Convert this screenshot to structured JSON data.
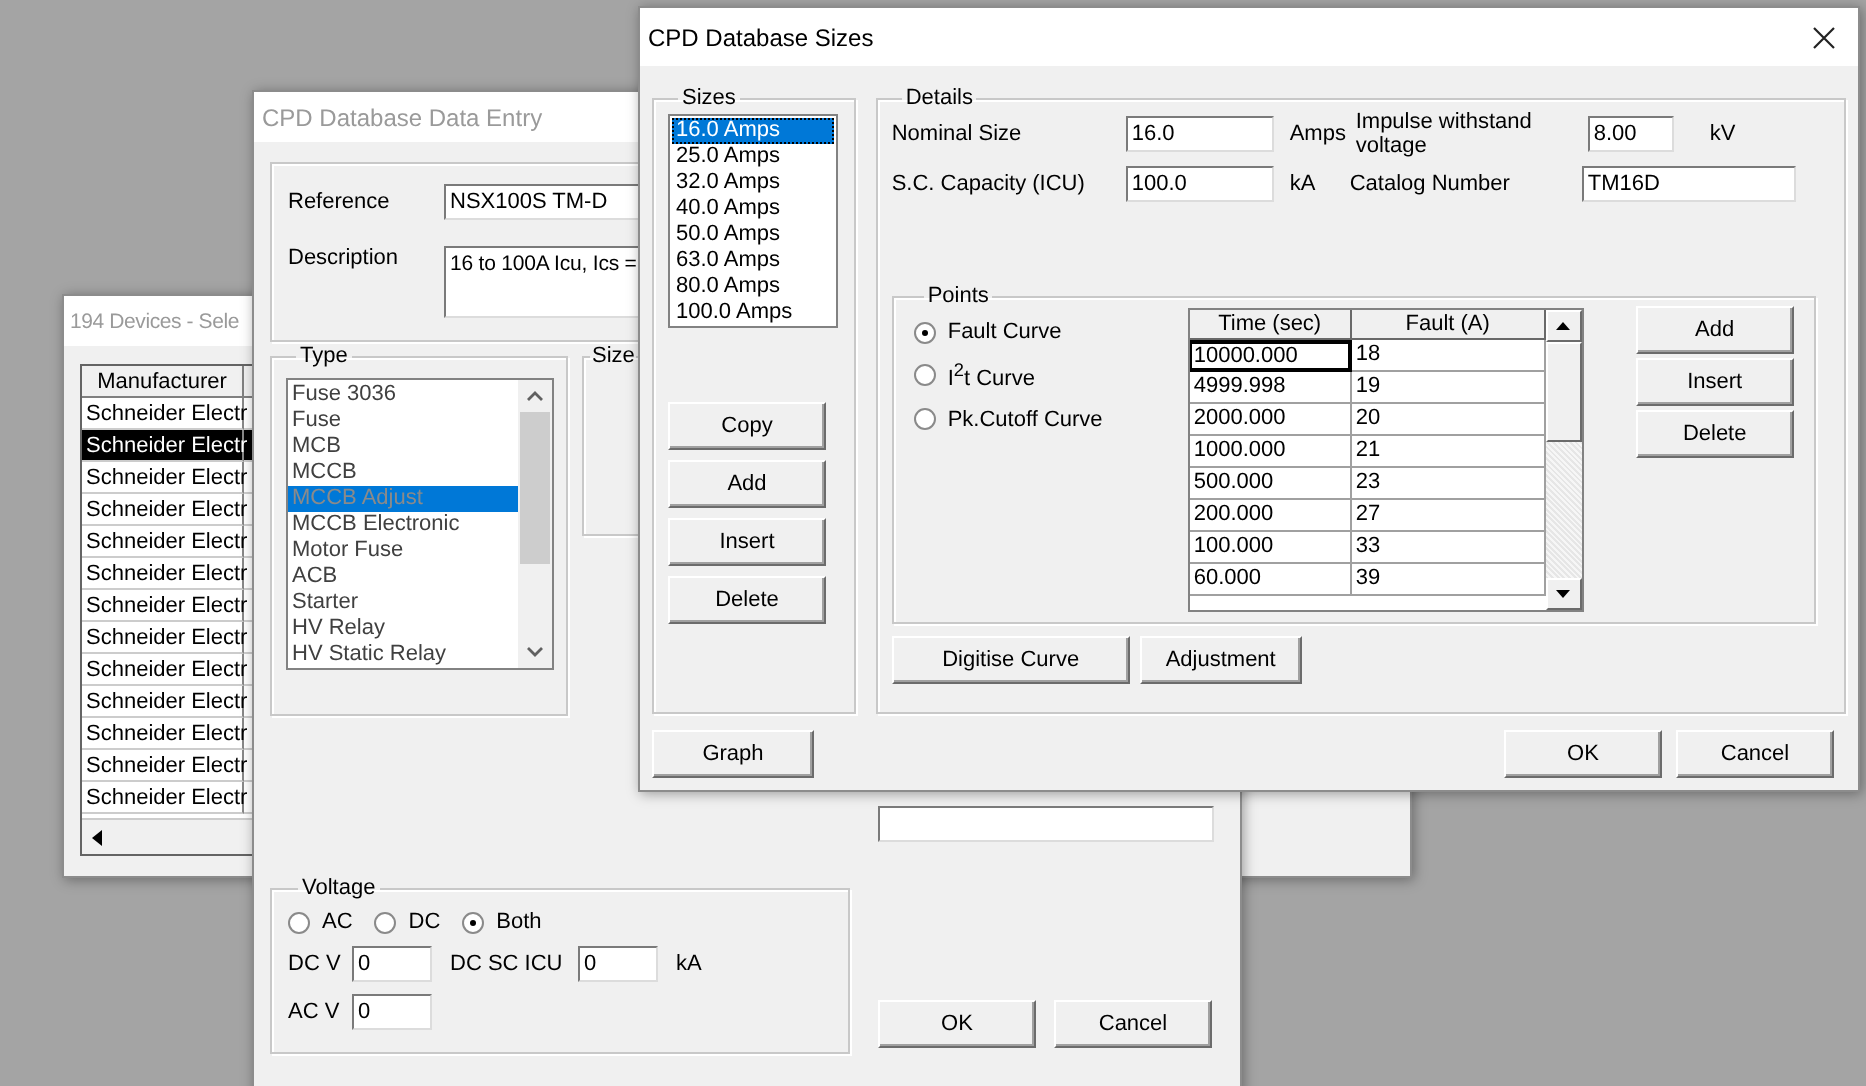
{
  "devices_window": {
    "title": "194 Devices - Sele",
    "columns": [
      "Manufacturer"
    ],
    "rows": [
      {
        "manufacturer": "Schneider Electr",
        "selected": false
      },
      {
        "manufacturer": "Schneider Electr",
        "selected": true
      },
      {
        "manufacturer": "Schneider Electr",
        "selected": false
      },
      {
        "manufacturer": "Schneider Electr",
        "selected": false
      },
      {
        "manufacturer": "Schneider Electr",
        "selected": false
      },
      {
        "manufacturer": "Schneider Electr",
        "selected": false
      },
      {
        "manufacturer": "Schneider Electr",
        "selected": false
      },
      {
        "manufacturer": "Schneider Electr",
        "selected": false
      },
      {
        "manufacturer": "Schneider Electr",
        "selected": false
      },
      {
        "manufacturer": "Schneider Electr",
        "selected": false
      },
      {
        "manufacturer": "Schneider Electr",
        "selected": false
      },
      {
        "manufacturer": "Schneider Electr",
        "selected": false
      },
      {
        "manufacturer": "Schneider Electr",
        "selected": false
      }
    ]
  },
  "entry_window": {
    "title": "CPD Database Data Entry",
    "reference_label": "Reference",
    "reference": "NSX100S TM-D",
    "description_label": "Description",
    "description": "16 to 100A Icu, Ics =",
    "type_group": "Type",
    "types": [
      {
        "label": "Fuse 3036",
        "selected": false
      },
      {
        "label": "Fuse",
        "selected": false
      },
      {
        "label": "MCB",
        "selected": false
      },
      {
        "label": "MCCB",
        "selected": false
      },
      {
        "label": "MCCB Adjust",
        "selected": true
      },
      {
        "label": "MCCB Electronic",
        "selected": false
      },
      {
        "label": "Motor Fuse",
        "selected": false
      },
      {
        "label": "ACB",
        "selected": false
      },
      {
        "label": "Starter",
        "selected": false
      },
      {
        "label": "HV Relay",
        "selected": false
      },
      {
        "label": "HV Static Relay",
        "selected": false
      }
    ],
    "size_group": "Size",
    "voltage_group": "Voltage",
    "voltage_options": [
      {
        "label": "AC",
        "selected": false
      },
      {
        "label": "DC",
        "selected": false
      },
      {
        "label": "Both",
        "selected": true
      }
    ],
    "dc_v_label": "DC V",
    "dc_v": "0",
    "dc_sc_icu_label": "DC SC ICU",
    "dc_sc_icu": "0",
    "dc_sc_icu_unit": "kA",
    "ac_v_label": "AC V",
    "ac_v": "0",
    "buttons": [
      "OK",
      "Cancel"
    ]
  },
  "sizes_window": {
    "title": "CPD Database Sizes",
    "sizes_group": "Sizes",
    "sizes": [
      {
        "label": "16.0 Amps",
        "selected": true
      },
      {
        "label": "25.0 Amps",
        "selected": false
      },
      {
        "label": "32.0 Amps",
        "selected": false
      },
      {
        "label": "40.0 Amps",
        "selected": false
      },
      {
        "label": "50.0 Amps",
        "selected": false
      },
      {
        "label": "63.0 Amps",
        "selected": false
      },
      {
        "label": "80.0 Amps",
        "selected": false
      },
      {
        "label": "100.0 Amps",
        "selected": false
      }
    ],
    "size_buttons": [
      "Copy",
      "Add",
      "Insert",
      "Delete"
    ],
    "details_group": "Details",
    "nominal_size_label": "Nominal Size",
    "nominal_size": "16.0",
    "nominal_size_unit": "Amps",
    "impulse_label": "Impulse withstand voltage",
    "impulse": "8.00",
    "impulse_unit": "kV",
    "sc_capacity_label": "S.C. Capacity (ICU)",
    "sc_capacity": "100.0",
    "sc_capacity_unit": "kA",
    "catalog_label": "Catalog Number",
    "catalog": "TM16D",
    "points_group": "Points",
    "curves": [
      {
        "label": "Fault Curve",
        "selected": true
      },
      {
        "label": "I$^{2}$t Curve",
        "selected": false
      },
      {
        "label": "Pk.Cutoff Curve",
        "selected": false
      }
    ],
    "points_table": {
      "columns": [
        "Time (sec)",
        "Fault (A)"
      ],
      "rows": [
        {
          "time": "10000.000",
          "fault": "18",
          "focused": true
        },
        {
          "time": "4999.998",
          "fault": "19",
          "focused": false
        },
        {
          "time": "2000.000",
          "fault": "20",
          "focused": false
        },
        {
          "time": "1000.000",
          "fault": "21",
          "focused": false
        },
        {
          "time": "500.000",
          "fault": "23",
          "focused": false
        },
        {
          "time": "200.000",
          "fault": "27",
          "focused": false
        },
        {
          "time": "100.000",
          "fault": "33",
          "focused": false
        },
        {
          "time": "60.000",
          "fault": "39",
          "focused": false
        }
      ]
    },
    "point_buttons": [
      "Add",
      "Insert",
      "Delete"
    ],
    "curve_buttons": [
      "Digitise Curve",
      "Adjustment"
    ],
    "graph_button": "Graph",
    "buttons": [
      "OK",
      "Cancel"
    ]
  }
}
